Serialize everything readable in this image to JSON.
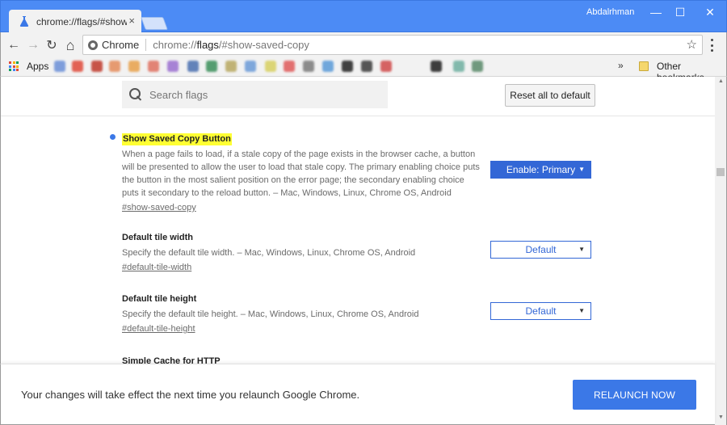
{
  "window": {
    "profile_name": "Abdalrhman",
    "minimize_glyph": "—",
    "maximize_glyph": "☐",
    "close_glyph": "✕"
  },
  "tab": {
    "title": "chrome://flags/#show-saved-copy",
    "close_glyph": "×",
    "favicon": "flask-icon"
  },
  "toolbar": {
    "back_glyph": "←",
    "forward_glyph": "→",
    "reload_glyph": "↻",
    "home_glyph": "⌂",
    "site_chip": "Chrome",
    "url_scheme": "chrome://",
    "url_host": "flags",
    "url_fragment": "/#show-saved-copy",
    "star_glyph": "☆"
  },
  "bookmarks": {
    "apps_label": "Apps",
    "more_glyph": "»",
    "other_label": "Other bookmarks",
    "blurred_favicon_colors": [
      "#6a8fd8",
      "#e04a3a",
      "#c0392b",
      "#e58b5a",
      "#e8a04a",
      "#e07060",
      "#9b6fd0",
      "#4a6fb0",
      "#3a8f5a",
      "#b8a860",
      "#6a9ad8",
      "#d8d060",
      "#e05a5a",
      "#7a7a7a",
      "#5a9ad8",
      "#222222",
      "#3a3a3a",
      "#d04a4a",
      "#1e1e1e",
      "#6fb0a0",
      "#5a8a6a"
    ]
  },
  "page": {
    "search_placeholder": "Search flags",
    "reset_label": "Reset all to default",
    "flags": [
      {
        "title": "Show Saved Copy Button",
        "description": "When a page fails to load, if a stale copy of the page exists in the browser cache, a button will be presented to allow the user to load that stale copy. The primary enabling choice puts the button in the most salient position on the error page; the secondary enabling choice puts it secondary to the reload button. – Mac, Windows, Linux, Chrome OS, Android",
        "link": "#show-saved-copy",
        "value": "Enable: Primary"
      },
      {
        "title": "Default tile width",
        "description": "Specify the default tile width. – Mac, Windows, Linux, Chrome OS, Android",
        "link": "#default-tile-width",
        "value": "Default"
      },
      {
        "title": "Default tile height",
        "description": "Specify the default tile height. – Mac, Windows, Linux, Chrome OS, Android",
        "link": "#default-tile-height",
        "value": "Default"
      },
      {
        "title": "Simple Cache for HTTP"
      }
    ],
    "select_caret": "▼"
  },
  "relaunch": {
    "message": "Your changes will take effect the next time you relaunch Google Chrome.",
    "button_label": "RELAUNCH NOW"
  },
  "colors": {
    "titlebar": "#4c8bf5",
    "accent": "#3367d6",
    "highlight": "#ffff33",
    "relaunch_button": "#3b78e7"
  }
}
